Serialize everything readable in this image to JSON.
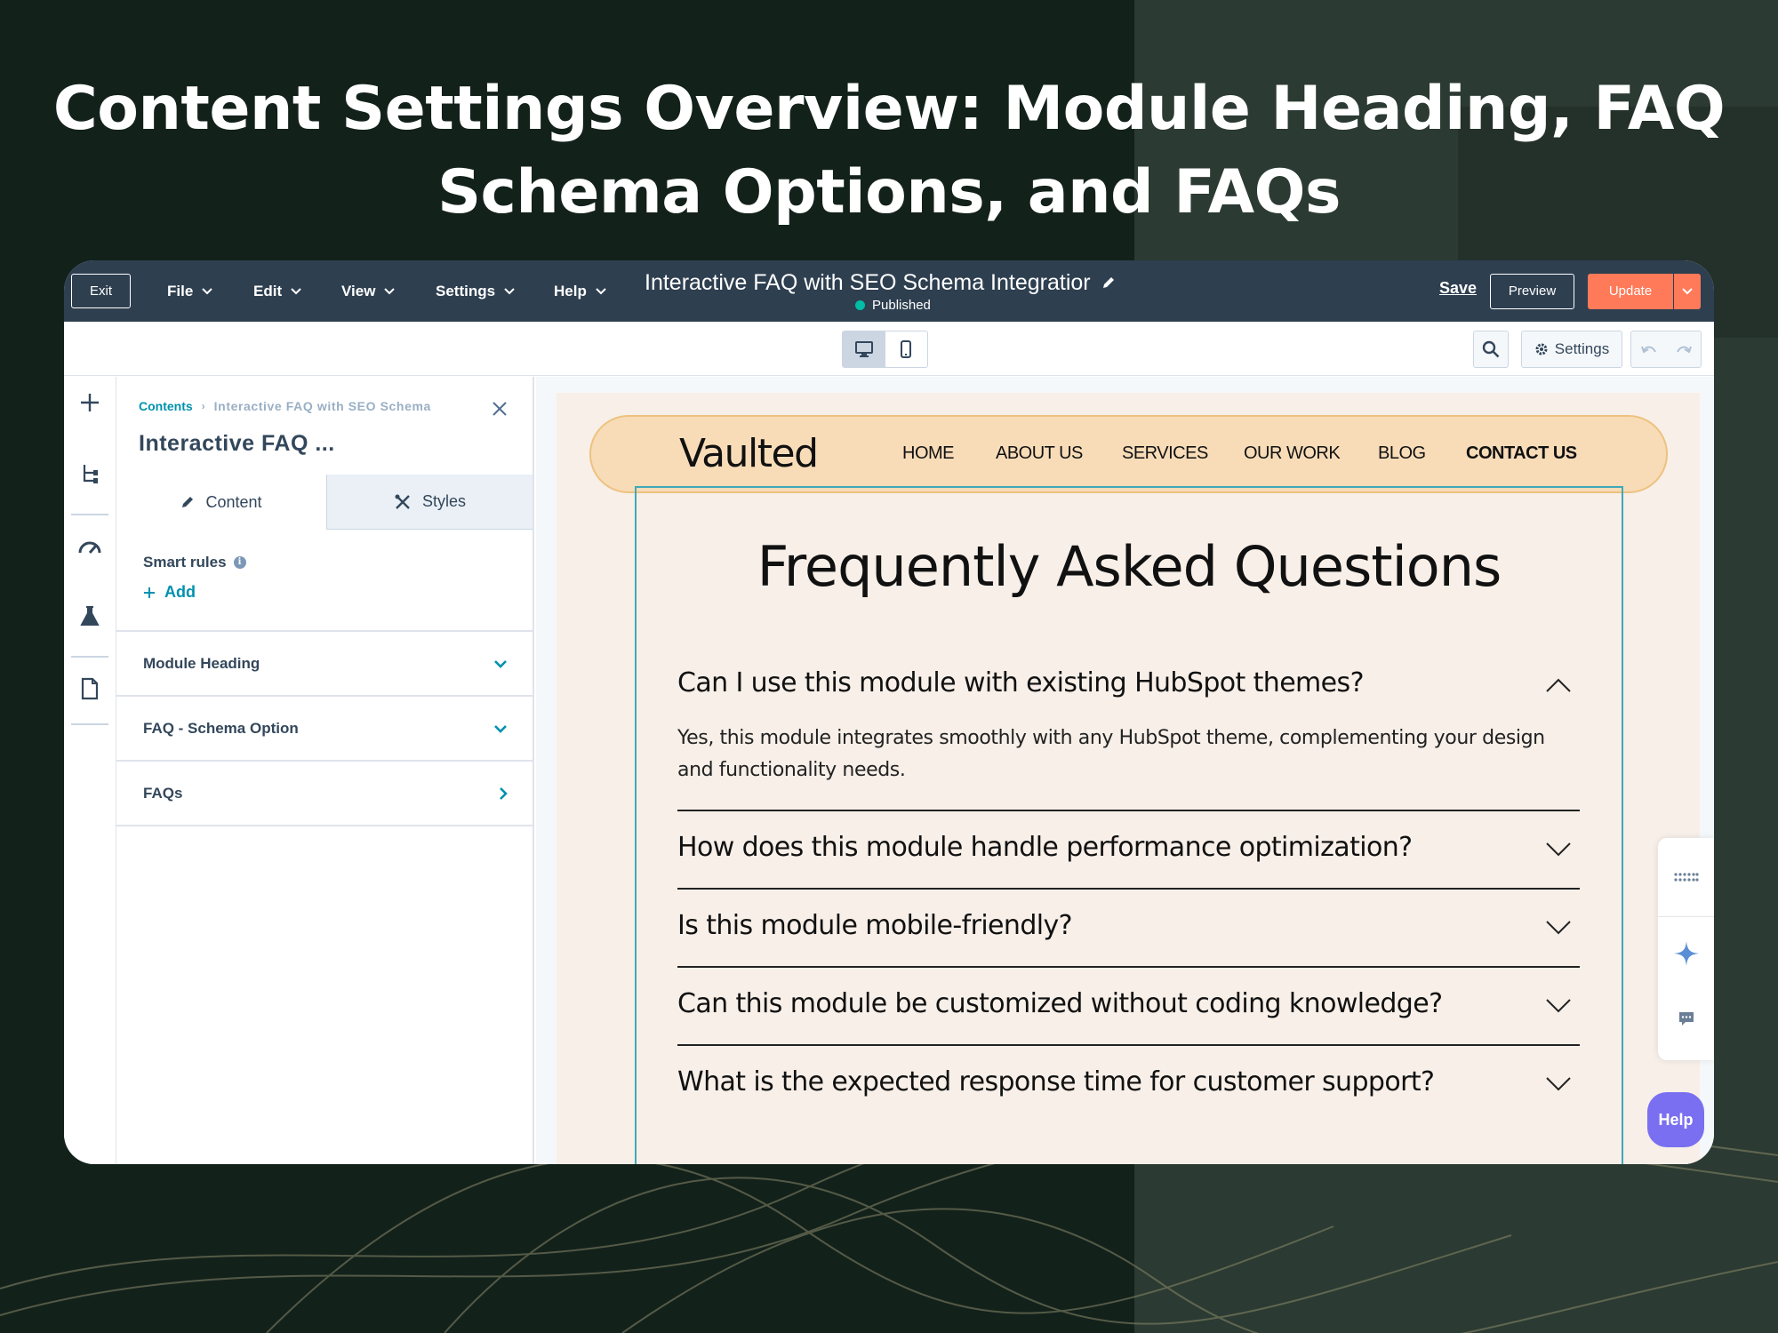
{
  "hero": {
    "title_line1": "Content Settings Overview: Module Heading, FAQ",
    "title_line2": "Schema Options, and FAQs"
  },
  "topbar": {
    "exit_label": "Exit",
    "menus": [
      "File",
      "Edit",
      "View",
      "Settings",
      "Help"
    ],
    "page_title": "Interactive FAQ with SEO Schema Integratior",
    "status": "Published",
    "save_label": "Save",
    "preview_label": "Preview",
    "update_label": "Update"
  },
  "toolbar": {
    "settings_label": "Settings"
  },
  "sidebar": {
    "breadcrumb_root": "Contents",
    "breadcrumb_current": "Interactive FAQ with SEO Schema",
    "title": "Interactive FAQ ...",
    "tabs": [
      "Content",
      "Styles"
    ],
    "smart_rules_label": "Smart rules",
    "add_label": "Add",
    "sections": [
      "Module Heading",
      "FAQ - Schema Option",
      "FAQs"
    ]
  },
  "preview": {
    "logo": "Vaulted",
    "nav": [
      "HOME",
      "ABOUT US",
      "SERVICES",
      "OUR WORK",
      "BLOG",
      "CONTACT US"
    ],
    "heading": "Frequently Asked Questions",
    "faqs": [
      "Can I use this module with existing HubSpot themes?",
      "How does this module handle performance optimization?",
      "Is this module mobile-friendly?",
      "Can this module be customized without coding knowledge?",
      "What is the expected response time for customer support?"
    ],
    "open_answer": "Yes, this module integrates smoothly with any HubSpot theme, complementing your design and functionality needs."
  },
  "widgets": {
    "help_label": "Help"
  },
  "colors": {
    "topbar": "#2e3f50",
    "accent": "#0091ae",
    "update": "#ff7a59",
    "published": "#00bda5",
    "help": "#7a6ff0"
  }
}
